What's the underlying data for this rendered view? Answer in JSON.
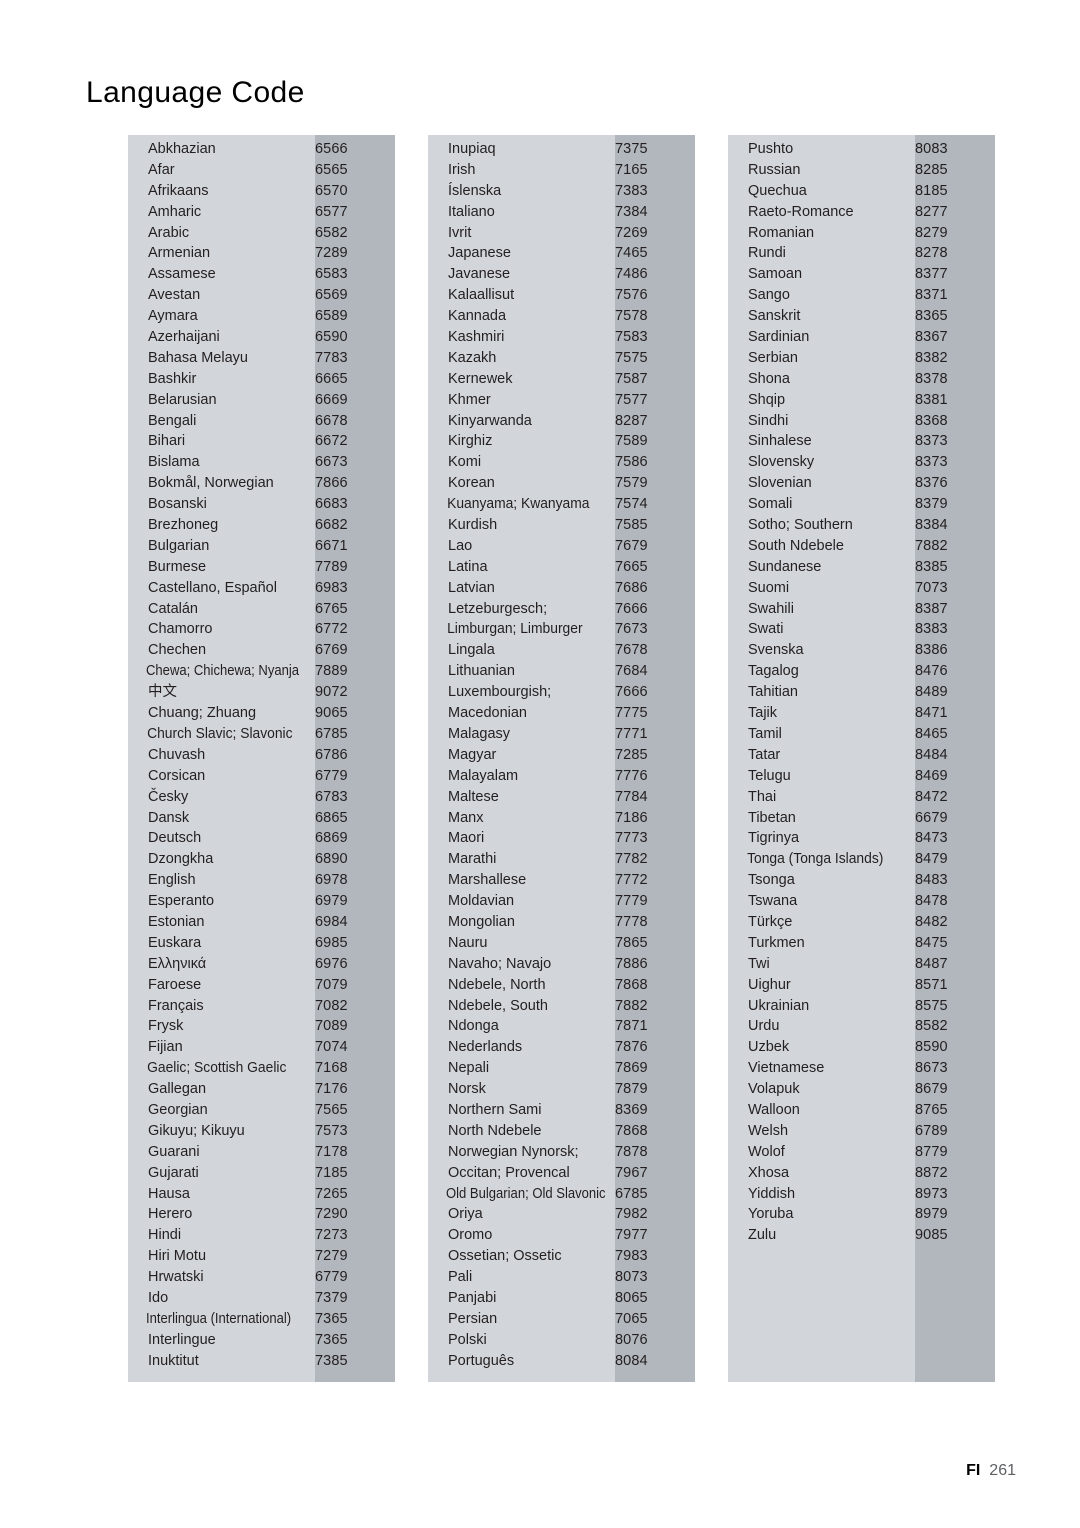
{
  "title": "Language Code",
  "footer": {
    "locale": "FI",
    "page_number": "261"
  },
  "colors": {
    "panel_name_bg": "#d2d6da",
    "panel_code_bg": "#b2b7bd",
    "text": "#231f20",
    "page_bg": "#ffffff"
  },
  "columns": [
    {
      "rows": [
        {
          "language": "Abkhazian",
          "code": "6566"
        },
        {
          "language": "Afar",
          "code": "6565"
        },
        {
          "language": "Afrikaans",
          "code": "6570"
        },
        {
          "language": "Amharic",
          "code": "6577"
        },
        {
          "language": "Arabic",
          "code": "6582"
        },
        {
          "language": "Armenian",
          "code": "7289"
        },
        {
          "language": "Assamese",
          "code": "6583"
        },
        {
          "language": "Avestan",
          "code": "6569"
        },
        {
          "language": "Aymara",
          "code": "6589"
        },
        {
          "language": "Azerhaijani",
          "code": "6590"
        },
        {
          "language": "Bahasa Melayu",
          "code": "7783"
        },
        {
          "language": "Bashkir",
          "code": "6665"
        },
        {
          "language": "Belarusian",
          "code": "6669"
        },
        {
          "language": "Bengali",
          "code": "6678"
        },
        {
          "language": "Bihari",
          "code": "6672"
        },
        {
          "language": "Bislama",
          "code": "6673"
        },
        {
          "language": "Bokmål, Norwegian",
          "code": "7866"
        },
        {
          "language": "Bosanski",
          "code": "6683"
        },
        {
          "language": "Brezhoneg",
          "code": "6682"
        },
        {
          "language": "Bulgarian",
          "code": "6671"
        },
        {
          "language": "Burmese",
          "code": "7789"
        },
        {
          "language": "Castellano, Español",
          "code": "6983"
        },
        {
          "language": "Catalán",
          "code": "6765"
        },
        {
          "language": "Chamorro",
          "code": "6772"
        },
        {
          "language": "Chechen",
          "code": "6769"
        },
        {
          "language": "Chewa; Chichewa; Nyanja",
          "code": "7889",
          "squeeze": 2
        },
        {
          "language": "中文",
          "code": "9072",
          "cjk": true
        },
        {
          "language": "Chuang; Zhuang",
          "code": "9065"
        },
        {
          "language": "Church Slavic; Slavonic",
          "code": "6785",
          "squeeze": 1
        },
        {
          "language": "Chuvash",
          "code": "6786"
        },
        {
          "language": "Corsican",
          "code": "6779"
        },
        {
          "language": "Česky",
          "code": "6783"
        },
        {
          "language": "Dansk",
          "code": "6865"
        },
        {
          "language": "Deutsch",
          "code": "6869"
        },
        {
          "language": "Dzongkha",
          "code": "6890"
        },
        {
          "language": "English",
          "code": "6978"
        },
        {
          "language": "Esperanto",
          "code": "6979"
        },
        {
          "language": "Estonian",
          "code": "6984"
        },
        {
          "language": "Euskara",
          "code": "6985"
        },
        {
          "language": "Ελληνικά",
          "code": "6976"
        },
        {
          "language": "Faroese",
          "code": "7079"
        },
        {
          "language": "Français",
          "code": "7082"
        },
        {
          "language": "Frysk",
          "code": "7089"
        },
        {
          "language": "Fijian",
          "code": "7074"
        },
        {
          "language": "Gaelic; Scottish Gaelic",
          "code": "7168",
          "squeeze": 1
        },
        {
          "language": "Gallegan",
          "code": "7176"
        },
        {
          "language": "Georgian",
          "code": "7565"
        },
        {
          "language": "Gikuyu; Kikuyu",
          "code": "7573"
        },
        {
          "language": "Guarani",
          "code": "7178"
        },
        {
          "language": "Gujarati",
          "code": "7185"
        },
        {
          "language": "Hausa",
          "code": "7265"
        },
        {
          "language": "Herero",
          "code": "7290"
        },
        {
          "language": "Hindi",
          "code": "7273"
        },
        {
          "language": "Hiri Motu",
          "code": "7279"
        },
        {
          "language": "Hrwatski",
          "code": "6779"
        },
        {
          "language": "Ido",
          "code": "7379"
        },
        {
          "language": "Interlingua (International)",
          "code": "7365",
          "squeeze": 2
        },
        {
          "language": "Interlingue",
          "code": "7365"
        },
        {
          "language": "Inuktitut",
          "code": "7385"
        }
      ]
    },
    {
      "rows": [
        {
          "language": "Inupiaq",
          "code": "7375"
        },
        {
          "language": "Irish",
          "code": "7165"
        },
        {
          "language": "Íslenska",
          "code": "7383"
        },
        {
          "language": "Italiano",
          "code": "7384"
        },
        {
          "language": "Ivrit",
          "code": "7269"
        },
        {
          "language": "Japanese",
          "code": "7465"
        },
        {
          "language": "Javanese",
          "code": "7486"
        },
        {
          "language": "Kalaallisut",
          "code": "7576"
        },
        {
          "language": "Kannada",
          "code": "7578"
        },
        {
          "language": "Kashmiri",
          "code": "7583"
        },
        {
          "language": "Kazakh",
          "code": "7575"
        },
        {
          "language": "Kernewek",
          "code": "7587"
        },
        {
          "language": "Khmer",
          "code": "7577"
        },
        {
          "language": "Kinyarwanda",
          "code": "8287"
        },
        {
          "language": "Kirghiz",
          "code": "7589"
        },
        {
          "language": "Komi",
          "code": "7586"
        },
        {
          "language": "Korean",
          "code": "7579"
        },
        {
          "language": "Kuanyama; Kwanyama",
          "code": "7574",
          "squeeze": 1
        },
        {
          "language": "Kurdish",
          "code": "7585"
        },
        {
          "language": "Lao",
          "code": "7679"
        },
        {
          "language": "Latina",
          "code": "7665"
        },
        {
          "language": "Latvian",
          "code": "7686"
        },
        {
          "language": "Letzeburgesch;",
          "code": "7666"
        },
        {
          "language": "Limburgan; Limburger",
          "code": "7673",
          "squeeze": 1
        },
        {
          "language": "Lingala",
          "code": "7678"
        },
        {
          "language": "Lithuanian",
          "code": "7684"
        },
        {
          "language": "Luxembourgish;",
          "code": "7666"
        },
        {
          "language": "Macedonian",
          "code": "7775"
        },
        {
          "language": "Malagasy",
          "code": "7771"
        },
        {
          "language": "Magyar",
          "code": "7285"
        },
        {
          "language": "Malayalam",
          "code": "7776"
        },
        {
          "language": "Maltese",
          "code": "7784"
        },
        {
          "language": "Manx",
          "code": "7186"
        },
        {
          "language": "Maori",
          "code": "7773"
        },
        {
          "language": "Marathi",
          "code": "7782"
        },
        {
          "language": "Marshallese",
          "code": "7772"
        },
        {
          "language": "Moldavian",
          "code": "7779"
        },
        {
          "language": "Mongolian",
          "code": "7778"
        },
        {
          "language": "Nauru",
          "code": "7865"
        },
        {
          "language": "Navaho; Navajo",
          "code": "7886"
        },
        {
          "language": "Ndebele, North",
          "code": "7868"
        },
        {
          "language": "Ndebele, South",
          "code": "7882"
        },
        {
          "language": "Ndonga",
          "code": "7871"
        },
        {
          "language": "Nederlands",
          "code": "7876"
        },
        {
          "language": "Nepali",
          "code": "7869"
        },
        {
          "language": "Norsk",
          "code": "7879"
        },
        {
          "language": "Northern Sami",
          "code": "8369"
        },
        {
          "language": "North Ndebele",
          "code": "7868"
        },
        {
          "language": "Norwegian Nynorsk;",
          "code": "7878"
        },
        {
          "language": "Occitan; Provencal",
          "code": "7967"
        },
        {
          "language": "Old Bulgarian; Old Slavonic",
          "code": "6785",
          "squeeze": 2
        },
        {
          "language": "Oriya",
          "code": "7982"
        },
        {
          "language": "Oromo",
          "code": "7977"
        },
        {
          "language": "Ossetian; Ossetic",
          "code": "7983"
        },
        {
          "language": "Pali",
          "code": "8073"
        },
        {
          "language": "Panjabi",
          "code": "8065"
        },
        {
          "language": "Persian",
          "code": "7065"
        },
        {
          "language": "Polski",
          "code": "8076"
        },
        {
          "language": "Português",
          "code": "8084"
        }
      ]
    },
    {
      "rows": [
        {
          "language": "Pushto",
          "code": "8083"
        },
        {
          "language": "Russian",
          "code": "8285"
        },
        {
          "language": "Quechua",
          "code": "8185"
        },
        {
          "language": "Raeto-Romance",
          "code": "8277"
        },
        {
          "language": "Romanian",
          "code": "8279"
        },
        {
          "language": "Rundi",
          "code": "8278"
        },
        {
          "language": "Samoan",
          "code": "8377"
        },
        {
          "language": "Sango",
          "code": "8371"
        },
        {
          "language": "Sanskrit",
          "code": "8365"
        },
        {
          "language": "Sardinian",
          "code": "8367"
        },
        {
          "language": "Serbian",
          "code": "8382"
        },
        {
          "language": "Shona",
          "code": "8378"
        },
        {
          "language": "Shqip",
          "code": "8381"
        },
        {
          "language": "Sindhi",
          "code": "8368"
        },
        {
          "language": "Sinhalese",
          "code": "8373"
        },
        {
          "language": "Slovensky",
          "code": "8373"
        },
        {
          "language": "Slovenian",
          "code": "8376"
        },
        {
          "language": "Somali",
          "code": "8379"
        },
        {
          "language": "Sotho; Southern",
          "code": "8384"
        },
        {
          "language": "South Ndebele",
          "code": "7882"
        },
        {
          "language": "Sundanese",
          "code": "8385"
        },
        {
          "language": "Suomi",
          "code": "7073"
        },
        {
          "language": "Swahili",
          "code": "8387"
        },
        {
          "language": "Swati",
          "code": "8383"
        },
        {
          "language": "Svenska",
          "code": "8386"
        },
        {
          "language": "Tagalog",
          "code": "8476"
        },
        {
          "language": "Tahitian",
          "code": "8489"
        },
        {
          "language": "Tajik",
          "code": "8471"
        },
        {
          "language": "Tamil",
          "code": "8465"
        },
        {
          "language": "Tatar",
          "code": "8484"
        },
        {
          "language": "Telugu",
          "code": "8469"
        },
        {
          "language": "Thai",
          "code": "8472"
        },
        {
          "language": "Tibetan",
          "code": "6679"
        },
        {
          "language": "Tigrinya",
          "code": "8473"
        },
        {
          "language": "Tonga (Tonga Islands)",
          "code": "8479",
          "squeeze": 1
        },
        {
          "language": "Tsonga",
          "code": "8483"
        },
        {
          "language": "Tswana",
          "code": "8478"
        },
        {
          "language": "Türkçe",
          "code": "8482"
        },
        {
          "language": "Turkmen",
          "code": "8475"
        },
        {
          "language": "Twi",
          "code": "8487"
        },
        {
          "language": "Uighur",
          "code": "8571"
        },
        {
          "language": "Ukrainian",
          "code": "8575"
        },
        {
          "language": "Urdu",
          "code": "8582"
        },
        {
          "language": "Uzbek",
          "code": "8590"
        },
        {
          "language": "Vietnamese",
          "code": "8673"
        },
        {
          "language": "Volapuk",
          "code": "8679"
        },
        {
          "language": "Walloon",
          "code": "8765"
        },
        {
          "language": "Welsh",
          "code": "6789"
        },
        {
          "language": "Wolof",
          "code": "8779"
        },
        {
          "language": "Xhosa",
          "code": "8872"
        },
        {
          "language": "Yiddish",
          "code": "8973"
        },
        {
          "language": "Yoruba",
          "code": "8979"
        },
        {
          "language": "Zulu",
          "code": "9085"
        }
      ]
    }
  ]
}
